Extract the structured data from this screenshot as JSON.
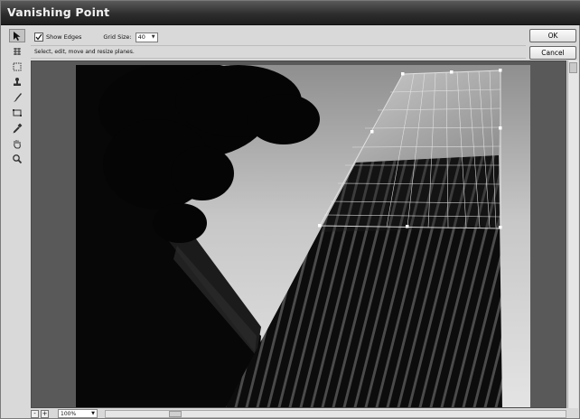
{
  "window": {
    "title": "Vanishing Point"
  },
  "toolbar": {
    "tools": [
      {
        "name": "edit-plane-tool",
        "icon": "arrow-pointer-icon",
        "active": true
      },
      {
        "name": "create-plane-tool",
        "icon": "create-plane-icon",
        "active": false
      },
      {
        "name": "marquee-tool",
        "icon": "marquee-icon",
        "active": false
      },
      {
        "name": "stamp-tool",
        "icon": "stamp-icon",
        "active": false
      },
      {
        "name": "brush-tool",
        "icon": "brush-icon",
        "active": false
      },
      {
        "name": "transform-tool",
        "icon": "transform-icon",
        "active": false
      },
      {
        "name": "eyedropper-tool",
        "icon": "eyedropper-icon",
        "active": false
      },
      {
        "name": "hand-tool",
        "icon": "hand-icon",
        "active": false
      },
      {
        "name": "zoom-tool",
        "icon": "zoom-icon",
        "active": false
      }
    ]
  },
  "options": {
    "show_edges_label": "Show Edges",
    "show_edges_checked": true,
    "grid_size_label": "Grid Size:",
    "grid_size_value": "40"
  },
  "buttons": {
    "ok": "OK",
    "cancel": "Cancel"
  },
  "hint": "Select, edit, move and resize planes.",
  "status": {
    "zoom_value": "100%"
  },
  "colors": {
    "titlebar": "#2e2e2e",
    "canvas_bg": "#595959",
    "grid": "#e8e8e8"
  }
}
